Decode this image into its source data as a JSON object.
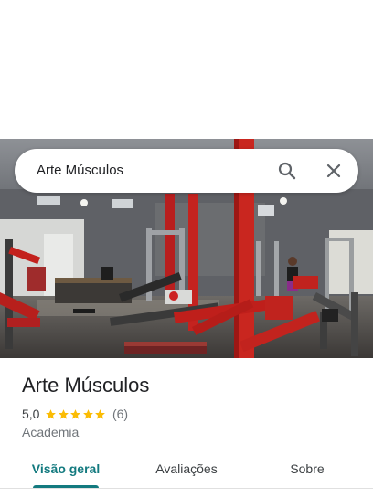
{
  "search": {
    "query": "Arte Músculos",
    "search_icon": "search-icon",
    "close_icon": "close-icon"
  },
  "photo": {
    "subject": "gym-interior-photo"
  },
  "place": {
    "name": "Arte Músculos",
    "rating": "5,0",
    "stars_filled": 5,
    "stars_total": 5,
    "review_count": "(6)",
    "category": "Academia"
  },
  "tabs": [
    {
      "label": "Visão geral",
      "active": true
    },
    {
      "label": "Avaliações",
      "active": false
    },
    {
      "label": "Sobre",
      "active": false
    }
  ],
  "colors": {
    "accent": "#137a7f",
    "star": "#fbbc04",
    "text_primary": "#202124",
    "text_secondary": "#70757a"
  }
}
